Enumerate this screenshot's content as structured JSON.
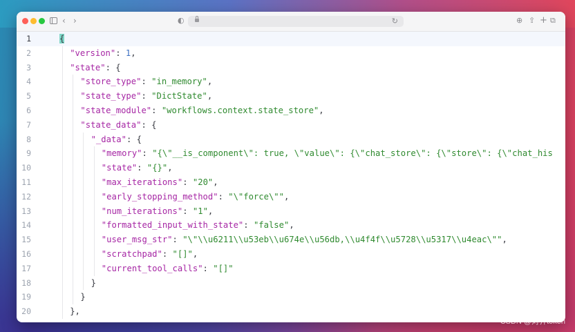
{
  "window": {
    "address_value": ""
  },
  "editor": {
    "lines": [
      {
        "num": "1",
        "indent": 0,
        "tokens": [
          {
            "t": "p",
            "v": "{"
          }
        ]
      },
      {
        "num": "2",
        "indent": 1,
        "tokens": [
          {
            "t": "k",
            "v": "\"version\""
          },
          {
            "t": "p",
            "v": ": "
          },
          {
            "t": "n",
            "v": "1"
          },
          {
            "t": "p",
            "v": ","
          }
        ]
      },
      {
        "num": "3",
        "indent": 1,
        "tokens": [
          {
            "t": "k",
            "v": "\"state\""
          },
          {
            "t": "p",
            "v": ": {"
          }
        ]
      },
      {
        "num": "4",
        "indent": 2,
        "tokens": [
          {
            "t": "k",
            "v": "\"store_type\""
          },
          {
            "t": "p",
            "v": ": "
          },
          {
            "t": "s",
            "v": "\"in_memory\""
          },
          {
            "t": "p",
            "v": ","
          }
        ]
      },
      {
        "num": "5",
        "indent": 2,
        "tokens": [
          {
            "t": "k",
            "v": "\"state_type\""
          },
          {
            "t": "p",
            "v": ": "
          },
          {
            "t": "s",
            "v": "\"DictState\""
          },
          {
            "t": "p",
            "v": ","
          }
        ]
      },
      {
        "num": "6",
        "indent": 2,
        "tokens": [
          {
            "t": "k",
            "v": "\"state_module\""
          },
          {
            "t": "p",
            "v": ": "
          },
          {
            "t": "s",
            "v": "\"workflows.context.state_store\""
          },
          {
            "t": "p",
            "v": ","
          }
        ]
      },
      {
        "num": "7",
        "indent": 2,
        "tokens": [
          {
            "t": "k",
            "v": "\"state_data\""
          },
          {
            "t": "p",
            "v": ": {"
          }
        ]
      },
      {
        "num": "8",
        "indent": 3,
        "tokens": [
          {
            "t": "k",
            "v": "\"_data\""
          },
          {
            "t": "p",
            "v": ": {"
          }
        ]
      },
      {
        "num": "9",
        "indent": 4,
        "tokens": [
          {
            "t": "k",
            "v": "\"memory\""
          },
          {
            "t": "p",
            "v": ": "
          },
          {
            "t": "s",
            "v": "\"{\\\"__is_component\\\": true, \\\"value\\\": {\\\"chat_store\\\": {\\\"store\\\": {\\\"chat_his"
          }
        ]
      },
      {
        "num": "10",
        "indent": 4,
        "tokens": [
          {
            "t": "k",
            "v": "\"state\""
          },
          {
            "t": "p",
            "v": ": "
          },
          {
            "t": "s",
            "v": "\"{}\""
          },
          {
            "t": "p",
            "v": ","
          }
        ]
      },
      {
        "num": "11",
        "indent": 4,
        "tokens": [
          {
            "t": "k",
            "v": "\"max_iterations\""
          },
          {
            "t": "p",
            "v": ": "
          },
          {
            "t": "s",
            "v": "\"20\""
          },
          {
            "t": "p",
            "v": ","
          }
        ]
      },
      {
        "num": "12",
        "indent": 4,
        "tokens": [
          {
            "t": "k",
            "v": "\"early_stopping_method\""
          },
          {
            "t": "p",
            "v": ": "
          },
          {
            "t": "s",
            "v": "\"\\\"force\\\"\""
          },
          {
            "t": "p",
            "v": ","
          }
        ]
      },
      {
        "num": "13",
        "indent": 4,
        "tokens": [
          {
            "t": "k",
            "v": "\"num_iterations\""
          },
          {
            "t": "p",
            "v": ": "
          },
          {
            "t": "s",
            "v": "\"1\""
          },
          {
            "t": "p",
            "v": ","
          }
        ]
      },
      {
        "num": "14",
        "indent": 4,
        "tokens": [
          {
            "t": "k",
            "v": "\"formatted_input_with_state\""
          },
          {
            "t": "p",
            "v": ": "
          },
          {
            "t": "s",
            "v": "\"false\""
          },
          {
            "t": "p",
            "v": ","
          }
        ]
      },
      {
        "num": "15",
        "indent": 4,
        "tokens": [
          {
            "t": "k",
            "v": "\"user_msg_str\""
          },
          {
            "t": "p",
            "v": ": "
          },
          {
            "t": "s",
            "v": "\"\\\"\\\\u6211\\\\u53eb\\\\u674e\\\\u56db,\\\\u4f4f\\\\u5728\\\\u5317\\\\u4eac\\\"\""
          },
          {
            "t": "p",
            "v": ","
          }
        ]
      },
      {
        "num": "16",
        "indent": 4,
        "tokens": [
          {
            "t": "k",
            "v": "\"scratchpad\""
          },
          {
            "t": "p",
            "v": ": "
          },
          {
            "t": "s",
            "v": "\"[]\""
          },
          {
            "t": "p",
            "v": ","
          }
        ]
      },
      {
        "num": "17",
        "indent": 4,
        "tokens": [
          {
            "t": "k",
            "v": "\"current_tool_calls\""
          },
          {
            "t": "p",
            "v": ": "
          },
          {
            "t": "s",
            "v": "\"[]\""
          }
        ]
      },
      {
        "num": "18",
        "indent": 3,
        "tokens": [
          {
            "t": "p",
            "v": "}"
          }
        ]
      },
      {
        "num": "19",
        "indent": 2,
        "tokens": [
          {
            "t": "p",
            "v": "}"
          }
        ]
      },
      {
        "num": "20",
        "indent": 1,
        "tokens": [
          {
            "t": "p",
            "v": "},"
          }
        ]
      }
    ]
  },
  "watermark": "CSDN @对齐token",
  "colors": {
    "key": "#a626a4",
    "string": "#2f8a2f",
    "number": "#3b6fc2",
    "bracket_highlight": "#7fd6c7",
    "loading_bar": "#3b82f6"
  }
}
